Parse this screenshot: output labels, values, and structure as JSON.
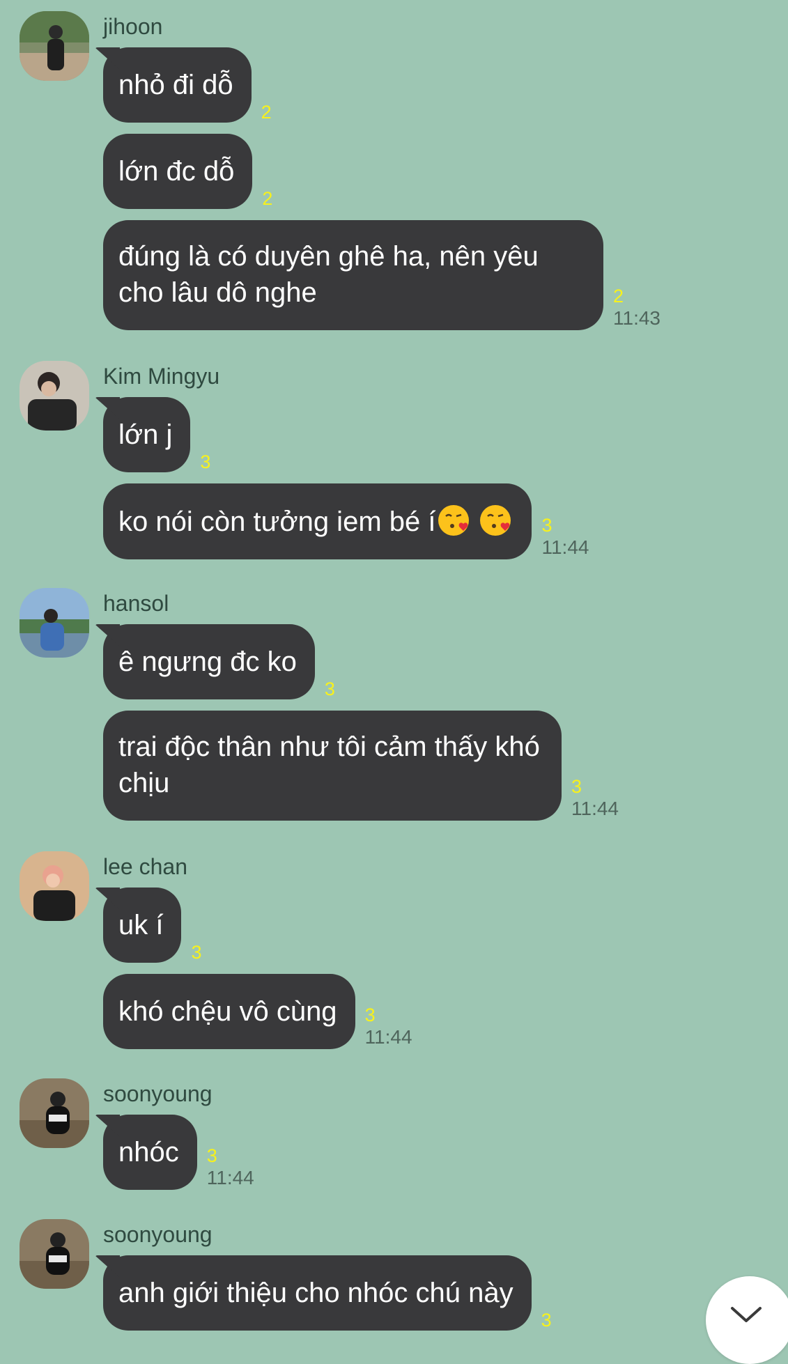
{
  "colors": {
    "background": "#9dc6b3",
    "bubble": "#39393b",
    "bubble_text": "#ffffff",
    "read_count": "#f7f11c",
    "time_text": "#4f655c",
    "sender_text": "#2f4a40"
  },
  "groups": [
    {
      "sender": "jihoon",
      "avatar_icon": "user-photo-icon",
      "messages": [
        {
          "text": "nhỏ đi dỗ",
          "read": "2",
          "time": ""
        },
        {
          "text": "lớn đc dỗ",
          "read": "2",
          "time": ""
        },
        {
          "text": "đúng là có duyên ghê ha, nên yêu cho lâu dô nghe",
          "read": "2",
          "time": "11:43"
        }
      ]
    },
    {
      "sender": "Kim Mingyu",
      "avatar_icon": "user-photo-icon",
      "messages": [
        {
          "text": "lớn j",
          "read": "3",
          "time": ""
        },
        {
          "text": "ko nói còn tưởng iem bé í",
          "emoji": "face-blowing-kiss-icon",
          "read": "3",
          "time": "11:44"
        }
      ]
    },
    {
      "sender": "hansol",
      "avatar_icon": "user-photo-icon",
      "messages": [
        {
          "text": "ê ngưng đc ko",
          "read": "3",
          "time": ""
        },
        {
          "text": "trai độc thân như tôi cảm thấy khó chịu",
          "read": "3",
          "time": "11:44"
        }
      ]
    },
    {
      "sender": "lee chan",
      "avatar_icon": "user-photo-icon",
      "messages": [
        {
          "text": "uk í",
          "read": "3",
          "time": ""
        },
        {
          "text": "khó chệu vô cùng",
          "read": "3",
          "time": "11:44"
        }
      ]
    },
    {
      "sender": "soonyoung",
      "avatar_icon": "user-photo-icon",
      "messages": [
        {
          "text": "nhóc",
          "read": "3",
          "time": "11:44"
        }
      ]
    },
    {
      "sender": "soonyoung",
      "avatar_icon": "user-photo-icon",
      "messages": [
        {
          "text": "anh giới thiệu cho nhóc chú này",
          "read": "3",
          "time": ""
        }
      ]
    }
  ],
  "scroll_button_icon": "chevron-down-icon"
}
